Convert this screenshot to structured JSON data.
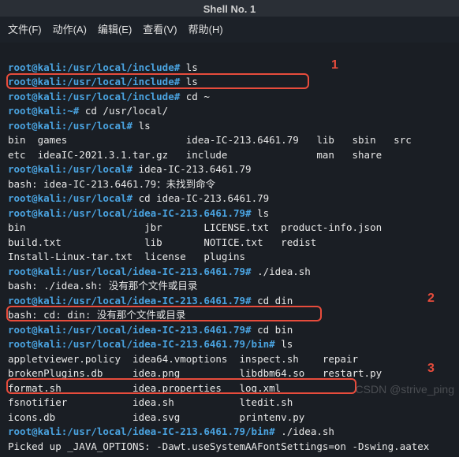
{
  "window": {
    "title": "Shell No. 1"
  },
  "menu": {
    "file": "文件(F)",
    "action": "动作(A)",
    "edit": "编辑(E)",
    "view": "查看(V)",
    "help": "帮助(H)"
  },
  "prompts": {
    "p1": "root@kali:/usr/local/include#",
    "p2": "root@kali:/usr/local/include#",
    "p3": "root@kali:/usr/local/include#",
    "p4": "root@kali:~#",
    "p5": "root@kali:/usr/local#",
    "p6": "root@kali:/usr/local#",
    "p7": "root@kali:/usr/local#",
    "p8": "root@kali:/usr/local/idea-IC-213.6461.79#",
    "p9": "root@kali:/usr/local/idea-IC-213.6461.79#",
    "p10": "root@kali:/usr/local/idea-IC-213.6461.79#",
    "p11": "root@kali:/usr/local/idea-IC-213.6461.79#",
    "p12": "root@kali:/usr/local/idea-IC-213.6461.79/bin#",
    "p13": "root@kali:/usr/local/idea-IC-213.6461.79/bin#"
  },
  "cmds": {
    "c1": "ls",
    "c2": "ls",
    "c3": "cd ~",
    "c4": "cd /usr/local/",
    "c5": "ls",
    "c6": "idea-IC-213.6461.79",
    "c7": "cd idea-IC-213.6461.79",
    "c8": "ls",
    "c9": "./idea.sh",
    "c10": "cd din",
    "c11": "cd bin",
    "c12": "ls",
    "c13": "./idea.sh"
  },
  "out": {
    "ls_usr_local_l1": "bin  games                    idea-IC-213.6461.79   lib   sbin   src",
    "ls_usr_local_l2": "etc  ideaIC-2021.3.1.tar.gz   include               man   share",
    "bash_notfound": "bash: idea-IC-213.6461.79：未找到命令",
    "ls_idea_l1": "bin                    jbr       LICENSE.txt  product-info.json",
    "ls_idea_l2": "build.txt              lib       NOTICE.txt   redist",
    "ls_idea_l3": "Install-Linux-tar.txt  license   plugins",
    "bash_nofile": "bash: ./idea.sh: 没有那个文件或目录",
    "bash_nodir": "bash: cd: din: 没有那个文件或目录",
    "ls_bin_l1": "appletviewer.policy  idea64.vmoptions  inspect.sh    repair",
    "ls_bin_l2": "brokenPlugins.db     idea.png          libdbm64.so   restart.py",
    "ls_bin_l3": "format.sh            idea.properties   log.xml",
    "ls_bin_l4": "fsnotifier           idea.sh           ltedit.sh",
    "ls_bin_l5": "icons.db             idea.svg          printenv.py",
    "picked_up": "Picked up _JAVA_OPTIONS: -Dawt.useSystemAAFontSettings=on -Dswing.aatex"
  },
  "annotations": {
    "label1": "1",
    "label2": "2",
    "label3": "3"
  },
  "watermark": {
    "line1": "CSDN @strive_ping"
  }
}
